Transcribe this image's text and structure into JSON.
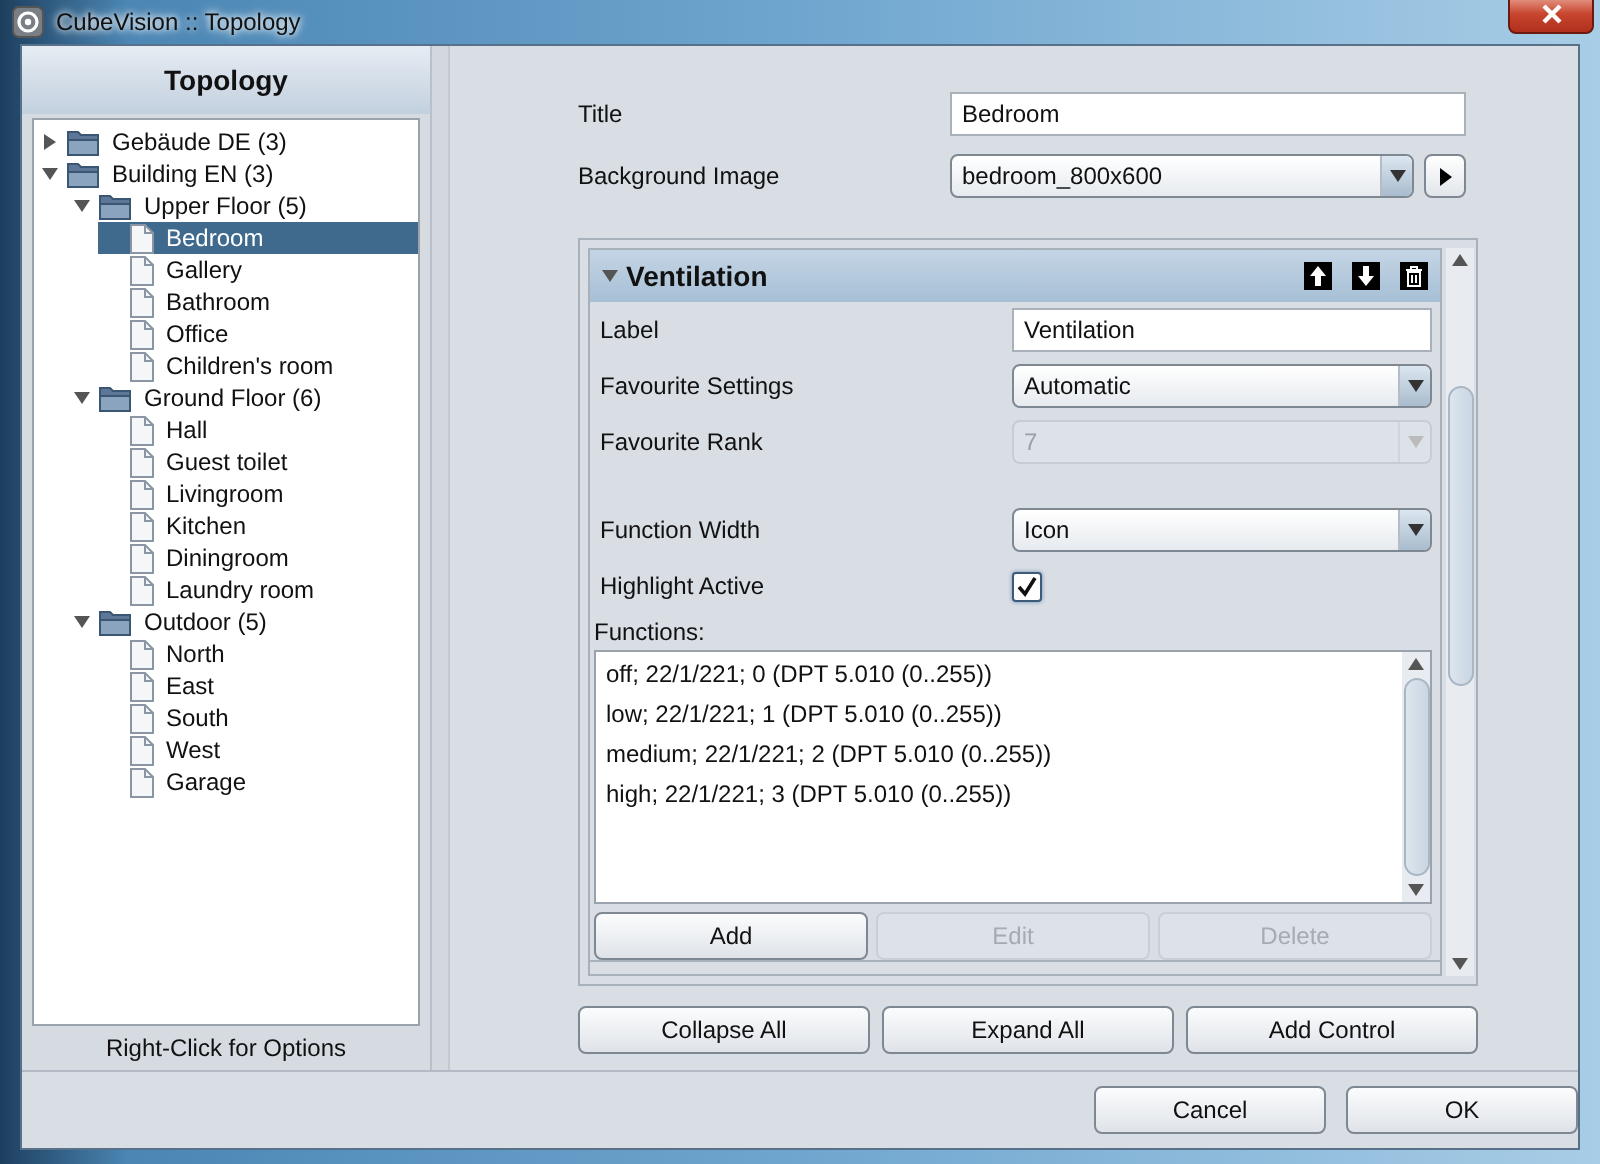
{
  "window": {
    "title": "CubeVision :: Topology"
  },
  "tree": {
    "title": "Topology",
    "footer": "Right-Click for Options",
    "items": [
      {
        "label": "Gebäude DE (3)",
        "kind": "folder",
        "expanded": false,
        "selected": false
      },
      {
        "label": "Building EN (3)",
        "kind": "folder",
        "expanded": true,
        "selected": false,
        "children": [
          {
            "label": "Upper Floor (5)",
            "kind": "folder",
            "expanded": true,
            "selected": false,
            "children": [
              {
                "label": "Bedroom",
                "kind": "page",
                "selected": true
              },
              {
                "label": "Gallery",
                "kind": "page",
                "selected": false
              },
              {
                "label": "Bathroom",
                "kind": "page",
                "selected": false
              },
              {
                "label": "Office",
                "kind": "page",
                "selected": false
              },
              {
                "label": "Children's room",
                "kind": "page",
                "selected": false
              }
            ]
          },
          {
            "label": "Ground Floor (6)",
            "kind": "folder",
            "expanded": true,
            "selected": false,
            "children": [
              {
                "label": "Hall",
                "kind": "page",
                "selected": false
              },
              {
                "label": "Guest toilet",
                "kind": "page",
                "selected": false
              },
              {
                "label": "Livingroom",
                "kind": "page",
                "selected": false
              },
              {
                "label": "Kitchen",
                "kind": "page",
                "selected": false
              },
              {
                "label": "Diningroom",
                "kind": "page",
                "selected": false
              },
              {
                "label": "Laundry room",
                "kind": "page",
                "selected": false
              }
            ]
          },
          {
            "label": "Outdoor (5)",
            "kind": "folder",
            "expanded": true,
            "selected": false,
            "children": [
              {
                "label": "North",
                "kind": "page",
                "selected": false
              },
              {
                "label": "East",
                "kind": "page",
                "selected": false
              },
              {
                "label": "South",
                "kind": "page",
                "selected": false
              },
              {
                "label": "West",
                "kind": "page",
                "selected": false
              },
              {
                "label": "Garage",
                "kind": "page",
                "selected": false
              }
            ]
          }
        ]
      }
    ]
  },
  "form": {
    "title": {
      "label": "Title",
      "value": "Bedroom"
    },
    "background_image": {
      "label": "Background Image",
      "value": "bedroom_800x600"
    }
  },
  "control": {
    "title": "Ventilation",
    "expanded": true,
    "fields": [
      {
        "kind": "text",
        "label": "Label",
        "value": "Ventilation"
      },
      {
        "kind": "select",
        "label": "Favourite Settings",
        "value": "Automatic",
        "disabled": false
      },
      {
        "kind": "select",
        "label": "Favourite Rank",
        "value": "7",
        "disabled": true
      },
      {
        "kind": "select",
        "label": "Function Width",
        "value": "Icon",
        "disabled": false
      },
      {
        "kind": "checkbox",
        "label": "Highlight Active",
        "checked": true
      }
    ],
    "functions_label": "Functions:",
    "functions": [
      "off; 22/1/221; 0 (DPT 5.010 (0..255))",
      "low; 22/1/221; 1 (DPT 5.010 (0..255))",
      "medium; 22/1/221; 2 (DPT 5.010 (0..255))",
      "high; 22/1/221; 3 (DPT 5.010 (0..255))"
    ],
    "buttons": [
      {
        "label": "Add",
        "disabled": false
      },
      {
        "label": "Edit",
        "disabled": true
      },
      {
        "label": "Delete",
        "disabled": true
      }
    ]
  },
  "actions": [
    "Collapse All",
    "Expand All",
    "Add Control"
  ],
  "dialog_buttons": [
    "Cancel",
    "OK"
  ]
}
